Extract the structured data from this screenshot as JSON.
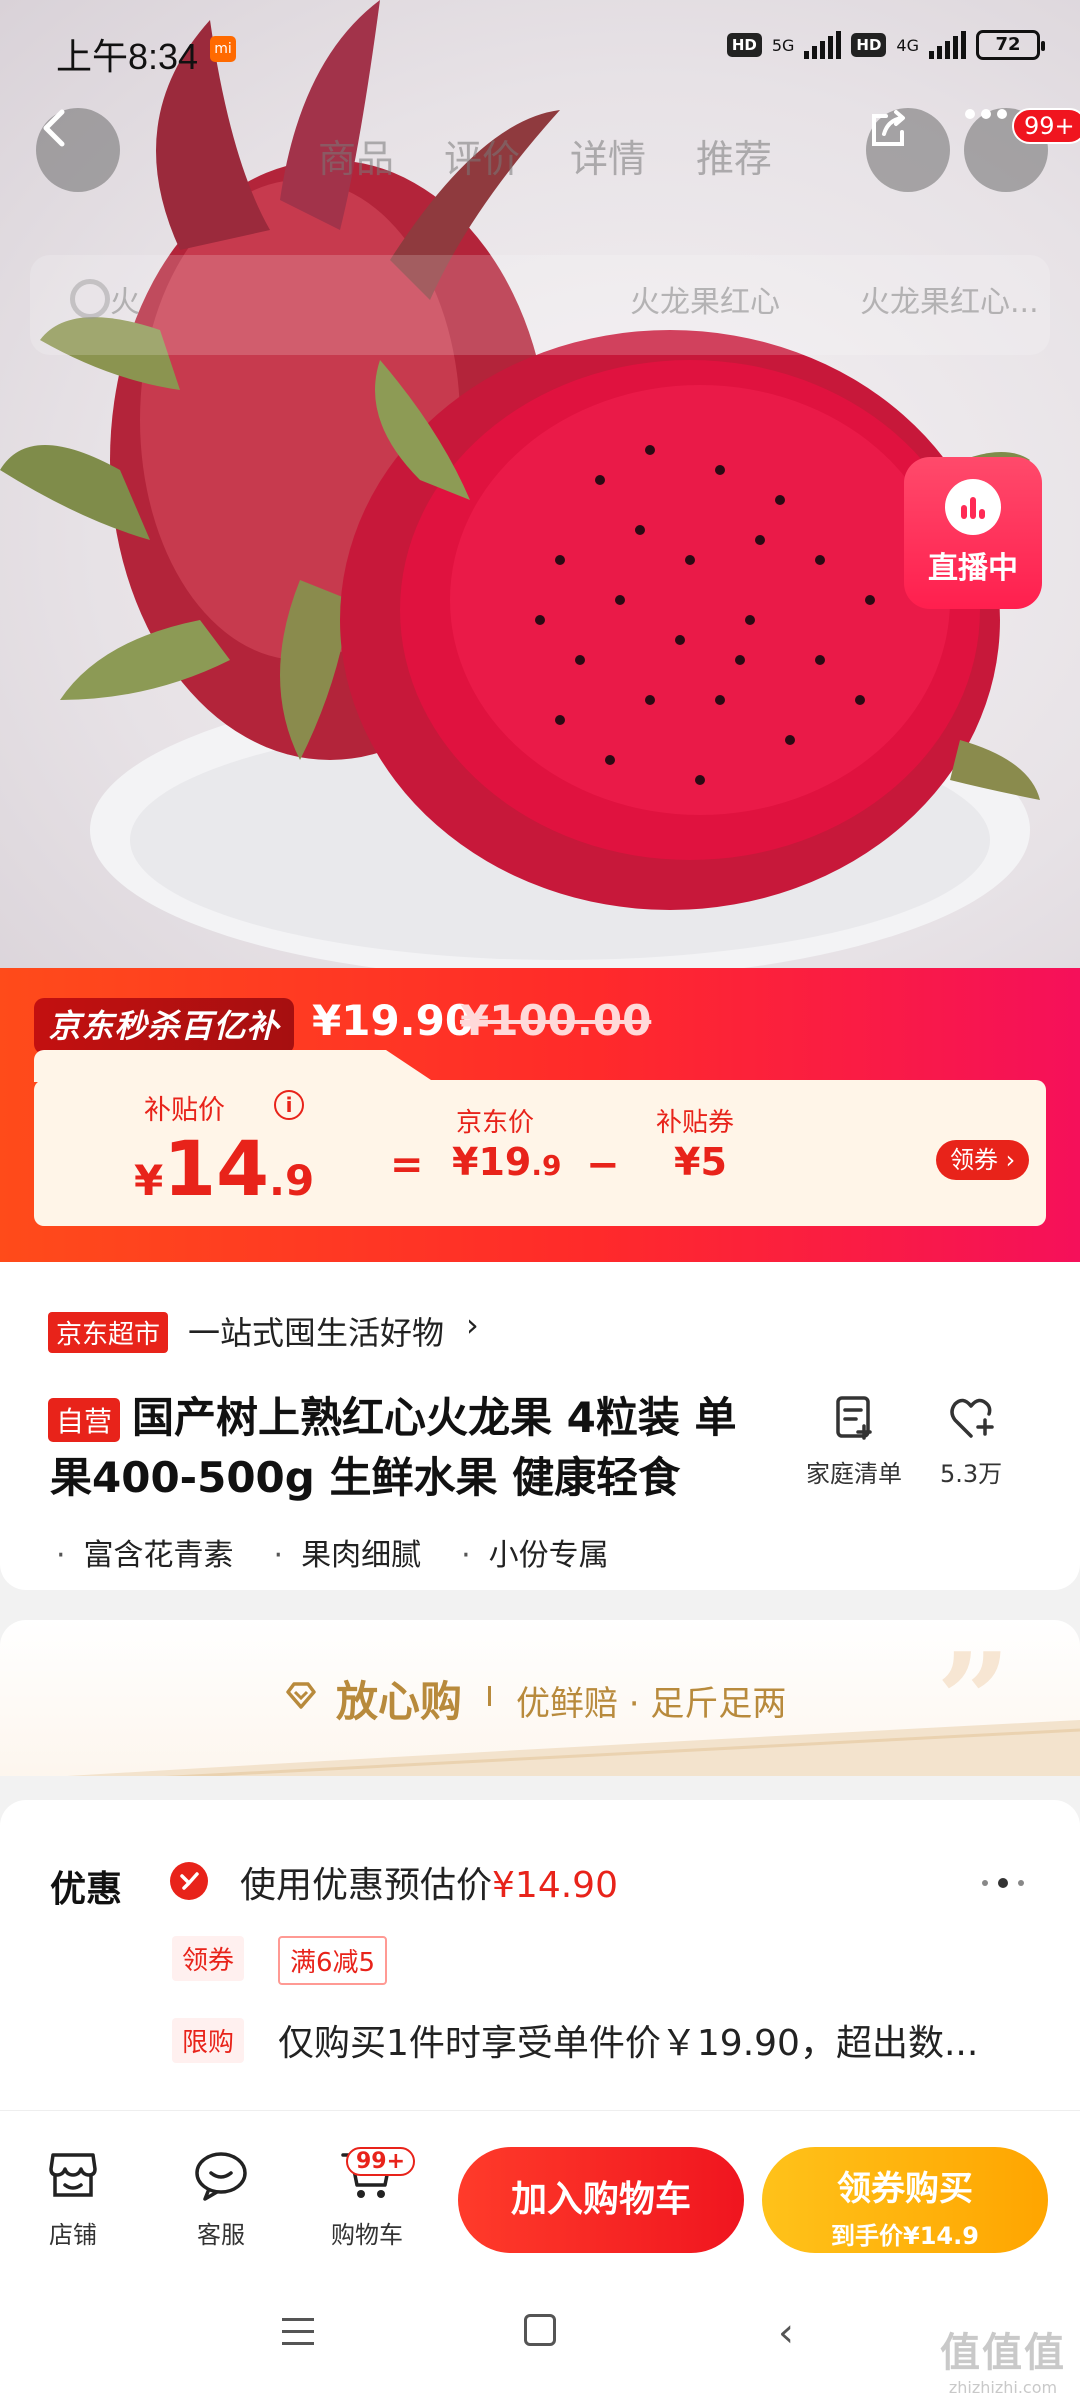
{
  "status_bar": {
    "time": "上午8:34",
    "mi_badge": "mi",
    "hd1": "HD",
    "net1": "5G",
    "hd2": "HD",
    "net2": "4G",
    "battery": "72"
  },
  "header": {
    "tabs": [
      "商品",
      "评价",
      "详情",
      "推荐"
    ],
    "more_badge": "99+",
    "search_chips": [
      "火",
      "火龙果红心",
      "火龙果红心..."
    ],
    "live_label": "直播中"
  },
  "banner": {
    "tag": "京东秒杀百亿补贴",
    "current_price": "¥19.90",
    "original_price": "¥100.00",
    "subsidy_label": "补贴价",
    "subsidy_price_currency": "¥",
    "subsidy_price_int": "14",
    "subsidy_price_dec": ".9",
    "equals": "=",
    "jd_label": "京东价",
    "jd_price_int": "¥19",
    "jd_price_dec": ".9",
    "minus": "−",
    "coupon_label": "补贴券",
    "coupon_value": "¥5",
    "coupon_pill": "领券 ›"
  },
  "product": {
    "market_tag": "京东超市",
    "slogan": "一站式囤生活好物",
    "slogan_arrow": "›",
    "self_tag": "自营",
    "title": "国产树上熟红心火龙果 4粒装 单果400-500g 生鲜水果 健康轻食",
    "list_label": "家庭清单",
    "fav_count": "5.3万",
    "features": [
      "富含花青素",
      "果肉细腻",
      "小份专属"
    ]
  },
  "assurance": {
    "title": "放心购",
    "subtitle": "优鲜赔 · 足斤足两"
  },
  "offers": {
    "heading": "优惠",
    "estimate_text": "使用优惠预估价",
    "estimate_price": "¥14.90",
    "tag_coupon": "领券",
    "tag_rule": "满6减5",
    "tag_limit": "限购",
    "limit_text": "仅购买1件时享受单件价￥19.90，超出数..."
  },
  "bottom_bar": {
    "shop_label": "店铺",
    "service_label": "客服",
    "cart_label": "购物车",
    "cart_badge": "99+",
    "add_cart": "加入购物车",
    "buy_line1": "领券购买",
    "buy_line2": "到手价¥14.9"
  },
  "watermark": {
    "line1": "值值值",
    "line2": "zhizhizhi.com"
  },
  "colors": {
    "jd_red": "#e8231a",
    "gold": "#b88a3c",
    "buy_yellow": "#ffa500"
  }
}
